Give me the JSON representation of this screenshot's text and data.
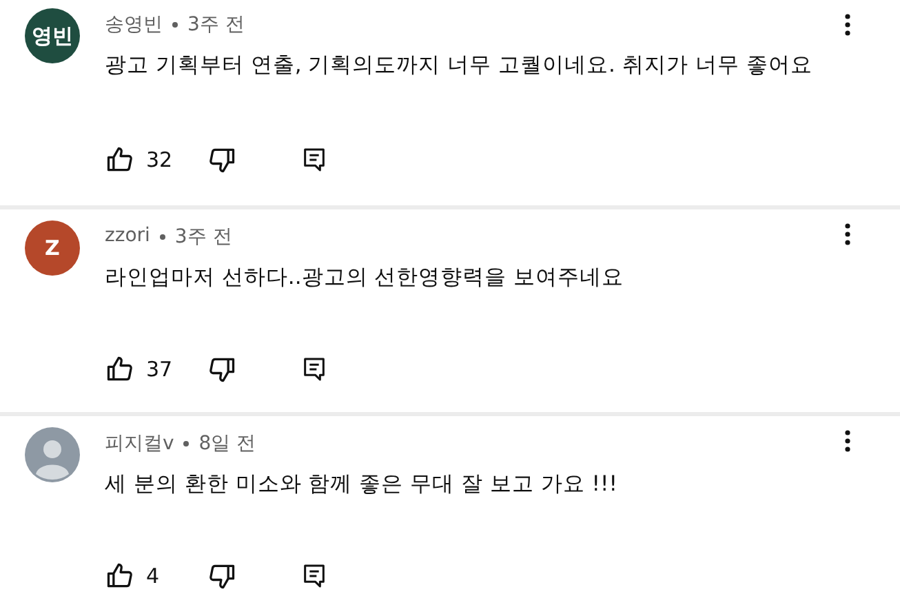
{
  "comments": [
    {
      "author": "송영빈",
      "time": "3주 전",
      "text": "광고 기획부터 연출, 기획의도까지 너무 고퀄이네요. 취지가 너무 좋어요",
      "likes": "32",
      "avatar": {
        "kind": "initials",
        "text": "영빈",
        "color": "#1f4d40"
      }
    },
    {
      "author": "zzori",
      "time": "3주 전",
      "text": "라인업마저 선하다..광고의 선한영향력을 보여주네요",
      "likes": "37",
      "avatar": {
        "kind": "initials",
        "text": "Z",
        "color": "#b5482a"
      }
    },
    {
      "author": "피지컬v",
      "time": "8일 전",
      "text": "세 분의 환한 미소와 함께 좋은 무대 잘 보고 가요 !!!",
      "likes": "4",
      "avatar": {
        "kind": "default"
      }
    }
  ]
}
